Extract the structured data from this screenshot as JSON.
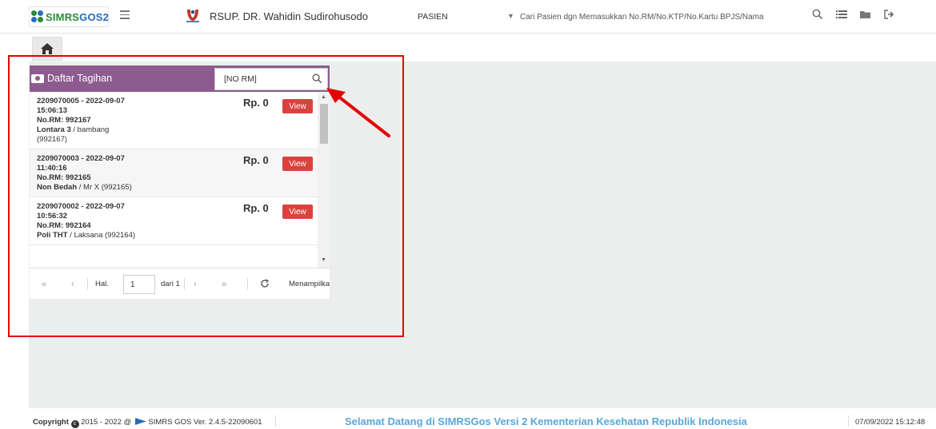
{
  "header": {
    "logo_text_a": "SIMRS",
    "logo_text_b": "GOS2",
    "hospital_name": "RSUP. DR. Wahidin Sudirohusodo",
    "patient_select_value": "PASIEN",
    "patient_search_placeholder": "Cari Pasien dgn Memasukkan No.RM/No.KTP/No.Kartu BPJS/Nama",
    "icons": [
      "menu-icon",
      "hospital-logo-icon",
      "search-icon",
      "list-icon",
      "folder-icon",
      "logout-icon"
    ]
  },
  "panel": {
    "title": "Daftar Tagihan",
    "rm_placeholder": "[NO RM]",
    "items": [
      {
        "line1": "2209070005 - 2022-09-07",
        "line2": "15:06:13",
        "rm": "No.RM: 992167",
        "unit": "Lontara 3",
        "patient": " / bambang",
        "patient_rm": "(992167)",
        "amount": "Rp. 0",
        "view_label": "View"
      },
      {
        "line1": "2209070003 - 2022-09-07",
        "line2": "11:40:16",
        "rm": "No.RM: 992165",
        "unit": "Non Bedah",
        "patient": " / Mr X (992165)",
        "patient_rm": "",
        "amount": "Rp. 0",
        "view_label": "View"
      },
      {
        "line1": "2209070002 - 2022-09-07",
        "line2": "10:56:32",
        "rm": "No.RM: 992164",
        "unit": "Poli THT",
        "patient": " / Laksana (992164)",
        "patient_rm": "",
        "amount": "Rp. 0",
        "view_label": "View"
      }
    ],
    "pager": {
      "first": "«",
      "prev": "‹",
      "page_label": "Hal.",
      "page_value": "1",
      "of_label": "dari 1",
      "next": "›",
      "last": "»",
      "showing": "Menampilkan"
    }
  },
  "footer": {
    "copyright_prefix": "Copyright",
    "copyright_text": "2015 - 2022 @",
    "version": "SIMRS GOS Ver. 2.4.5-22090601",
    "welcome": "Selamat Datang di SIMRSGos Versi 2 Kementerian Kesehatan Republik Indonesia",
    "datetime": "07/09/2022 15:12:48"
  },
  "colors": {
    "panel_header": "#8d5b8f",
    "view_button": "#d9433f",
    "annotation": "#e60000",
    "welcome_text": "#5aa6d8",
    "main_background": "#eceeee"
  }
}
